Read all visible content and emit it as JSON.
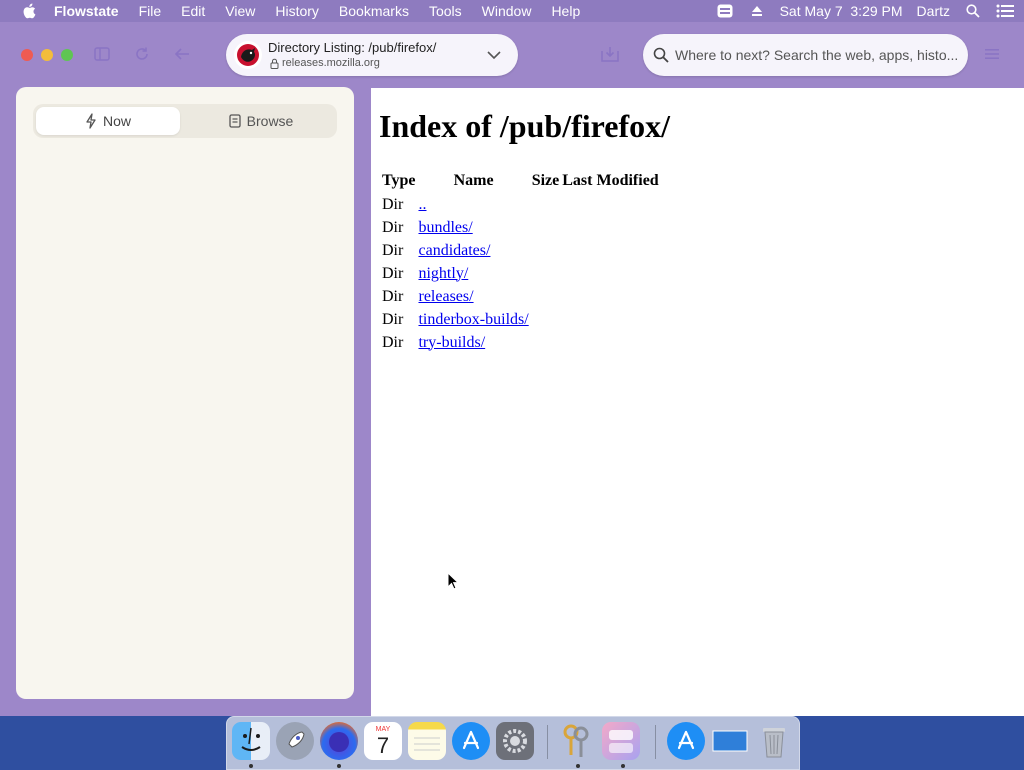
{
  "menubar": {
    "app_name": "Flowstate",
    "items": [
      "File",
      "Edit",
      "View",
      "History",
      "Bookmarks",
      "Tools",
      "Window",
      "Help"
    ],
    "clock": "Sat May 7  3:29 PM",
    "user": "Dartz"
  },
  "toolbar": {
    "tab_title": "Directory Listing: /pub/firefox/",
    "host": "releases.mozilla.org",
    "search_placeholder": "Where to next? Search the web, apps, histo..."
  },
  "sidebar": {
    "tabs": [
      {
        "label": "Now",
        "active": true
      },
      {
        "label": "Browse",
        "active": false
      }
    ]
  },
  "page": {
    "heading": "Index of /pub/firefox/",
    "columns": [
      "Type",
      "Name",
      "Size",
      "Last Modified"
    ],
    "rows": [
      {
        "type": "Dir",
        "name": ".."
      },
      {
        "type": "Dir",
        "name": "bundles/"
      },
      {
        "type": "Dir",
        "name": "candidates/"
      },
      {
        "type": "Dir",
        "name": "nightly/"
      },
      {
        "type": "Dir",
        "name": "releases/"
      },
      {
        "type": "Dir",
        "name": "tinderbox-builds/"
      },
      {
        "type": "Dir",
        "name": "try-builds/"
      }
    ]
  },
  "dock": {
    "calendar_month": "MAY",
    "calendar_day": "7",
    "apps": [
      "finder",
      "launchpad",
      "firefox",
      "calendar",
      "notes",
      "app-store",
      "system-preferences",
      "keychain-access",
      "flowstate",
      "app-store-downloads",
      "screen",
      "trash"
    ]
  },
  "colors": {
    "menubar": "#8e7bbf",
    "window_chrome": "#9d87c9",
    "link": "#0000ee",
    "sidebar_bg": "#f8f6ef"
  }
}
